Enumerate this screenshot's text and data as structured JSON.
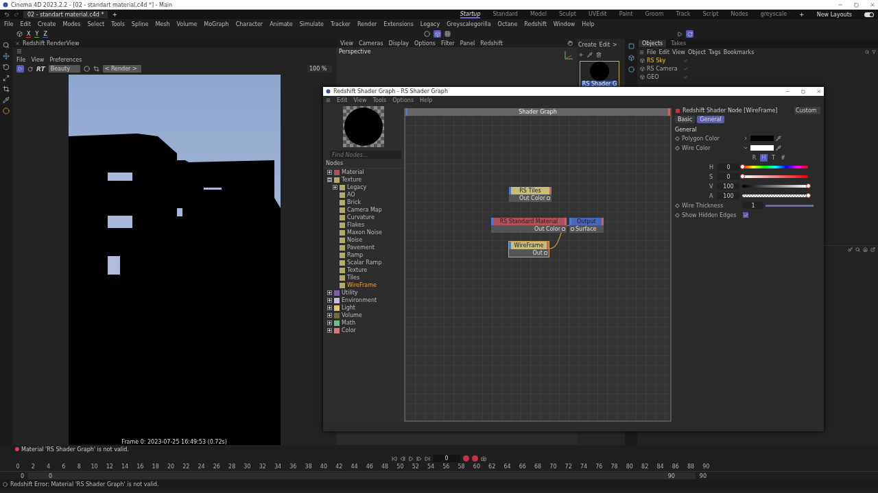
{
  "window": {
    "title": "Cinema 4D 2023.2.2 - [02 - standart material.c4d *] - Main"
  },
  "doc_tabs": [
    {
      "label": "02 - standart material.c4d *",
      "selected": true
    }
  ],
  "add_tab": "+",
  "layouts": [
    {
      "label": "Startup",
      "selected": true
    },
    {
      "label": "Standard",
      "selected": false
    },
    {
      "label": "Model",
      "selected": false
    },
    {
      "label": "Sculpt",
      "selected": false
    },
    {
      "label": "UVEdit",
      "selected": false
    },
    {
      "label": "Paint",
      "selected": false
    },
    {
      "label": "Groom",
      "selected": false
    },
    {
      "label": "Track",
      "selected": false
    },
    {
      "label": "Script",
      "selected": false
    },
    {
      "label": "Nodes",
      "selected": false
    },
    {
      "label": "greyscale",
      "selected": false
    }
  ],
  "layout_add": "+",
  "new_layouts": {
    "label": "New Layouts",
    "on": true
  },
  "menu": [
    "File",
    "Edit",
    "Create",
    "Modes",
    "Select",
    "Tools",
    "Spline",
    "Mesh",
    "Volume",
    "MoGraph",
    "Character",
    "Animate",
    "Simulate",
    "Tracker",
    "Render",
    "Extensions",
    "Legacy",
    "Greyscalegorilla",
    "Octane",
    "Redshift",
    "Window",
    "Help"
  ],
  "axis_buttons": [
    "X",
    "Y",
    "Z"
  ],
  "render_view": {
    "title": "Redshift RenderView",
    "menu": [
      "File",
      "View",
      "Preferences"
    ],
    "rt": "RT",
    "aov": "Beauty",
    "render_dropdown": "< Render >",
    "zoom": "100 %",
    "caption": "Frame 0:  2023-07-25  16:49:53  (0.72s)"
  },
  "viewport": {
    "menu": [
      "View",
      "Cameras",
      "Display",
      "Options",
      "Filter",
      "Panel",
      "Redshift"
    ],
    "camera": "Perspective"
  },
  "material_manager": {
    "menu": [
      "Create",
      "Edit",
      ">"
    ],
    "materials": [
      {
        "name": "RS Shader G",
        "selected": true
      }
    ]
  },
  "objects": {
    "tabs": [
      {
        "label": "Objects",
        "selected": true
      },
      {
        "label": "Takes",
        "selected": false
      }
    ],
    "menu": [
      "File",
      "Edit",
      "View",
      "Object",
      "Tags",
      "Bookmarks"
    ],
    "items": [
      {
        "name": "RS Sky",
        "selected": true
      },
      {
        "name": "RS Camera",
        "selected": false
      },
      {
        "name": "GEO",
        "selected": false
      }
    ]
  },
  "shader_graph": {
    "title": "Redshift Shader Graph - RS Shader Graph",
    "menu": [
      "Edit",
      "View",
      "Tools",
      "Options",
      "Help"
    ],
    "search_placeholder": "Find Nodes...",
    "nodes_header": "Nodes",
    "node_tree": [
      {
        "label": "Material",
        "color": "#a8525a",
        "expanded": false,
        "selected": false
      },
      {
        "label": "Texture",
        "color": "#b3ab6c",
        "expanded": true,
        "selected": false,
        "children": [
          {
            "label": "Legacy",
            "color": "#b3ab6c",
            "expanded": false,
            "selected": false
          },
          {
            "label": "AO",
            "color": "#b3ab6c",
            "selected": false
          },
          {
            "label": "Brick",
            "color": "#b3ab6c",
            "selected": false
          },
          {
            "label": "Camera Map",
            "color": "#b3ab6c",
            "selected": false
          },
          {
            "label": "Curvature",
            "color": "#b3ab6c",
            "selected": false
          },
          {
            "label": "Flakes",
            "color": "#b3ab6c",
            "selected": false
          },
          {
            "label": "Maxon Noise",
            "color": "#b3ab6c",
            "selected": false
          },
          {
            "label": "Noise",
            "color": "#b3ab6c",
            "selected": false
          },
          {
            "label": "Pavement",
            "color": "#b3ab6c",
            "selected": false
          },
          {
            "label": "Ramp",
            "color": "#b3ab6c",
            "selected": false
          },
          {
            "label": "Scalar Ramp",
            "color": "#b3ab6c",
            "selected": false
          },
          {
            "label": "Texture",
            "color": "#b3ab6c",
            "selected": false
          },
          {
            "label": "Tiles",
            "color": "#b3ab6c",
            "selected": false
          },
          {
            "label": "WireFrame",
            "color": "#b3ab6c",
            "selected": true
          }
        ]
      },
      {
        "label": "Utility",
        "color": "#7a62b0",
        "expanded": false,
        "selected": false
      },
      {
        "label": "Environment",
        "color": "#c9b8e0",
        "expanded": false,
        "selected": false
      },
      {
        "label": "Light",
        "color": "#e0c870",
        "expanded": false,
        "selected": false
      },
      {
        "label": "Volume",
        "color": "#6e6a44",
        "expanded": false,
        "selected": false
      },
      {
        "label": "Math",
        "color": "#6cbf8a",
        "expanded": false,
        "selected": false
      },
      {
        "label": "Color",
        "color": "#d47a7a",
        "expanded": false,
        "selected": false
      }
    ],
    "canvas_title": "Shader Graph",
    "graph_nodes": [
      {
        "kind": "shader",
        "title": "RS Tiles",
        "port": "Out Color",
        "color": "#c9bd72",
        "selected": false
      },
      {
        "kind": "shader",
        "title": "RS Standard Material",
        "port": "Out Color",
        "color": "#b0505a",
        "selected": false
      },
      {
        "kind": "shader",
        "title": "WireFrame",
        "port": "Out",
        "color": "#c9bd72",
        "selected": true
      },
      {
        "kind": "output",
        "title": "Output",
        "port": "Surface",
        "color": "#4a66b8",
        "selected": false
      }
    ],
    "properties": {
      "title": "Redshift Shader Node [WireFrame]",
      "preset": "Custom",
      "tabs": [
        {
          "label": "Basic",
          "selected": false
        },
        {
          "label": "General",
          "selected": true
        }
      ],
      "section": "General",
      "fields": [
        {
          "label": "Polygon Color",
          "color": "#000000",
          "expanded": false
        },
        {
          "label": "Wire Color",
          "color": "#ffffff",
          "expanded": true
        }
      ],
      "color_modes": [
        {
          "label": "R",
          "selected": false
        },
        {
          "label": "H",
          "selected": true
        },
        {
          "label": "T",
          "selected": false
        },
        {
          "label": "#",
          "selected": false
        }
      ],
      "channels": [
        {
          "name": "H",
          "value": "0",
          "level": 0
        },
        {
          "name": "S",
          "value": "0",
          "level": 0
        },
        {
          "name": "V",
          "value": "100",
          "level": 1
        },
        {
          "name": "A",
          "value": "100",
          "level": 1
        }
      ],
      "wire_thickness": {
        "label": "Wire Thickness",
        "value": "1",
        "level": 1
      },
      "show_hidden_edges": {
        "label": "Show Hidden Edges",
        "checked": true
      }
    }
  },
  "status": {
    "message": "Material 'RS Shader Graph' is not valid.",
    "error": "Redshift Error: Material 'RS Shader Graph' is not valid."
  },
  "timeline": {
    "frame": "0",
    "ticks": [
      "0",
      "2",
      "4",
      "6",
      "8",
      "10",
      "12",
      "14",
      "16",
      "18",
      "20",
      "22",
      "24",
      "26",
      "28",
      "30",
      "32",
      "34",
      "36",
      "38",
      "40",
      "42",
      "44",
      "46",
      "48",
      "50",
      "52",
      "54",
      "56",
      "58",
      "60",
      "62",
      "64",
      "66",
      "68",
      "70",
      "72",
      "74",
      "76",
      "78",
      "80",
      "82",
      "84",
      "86",
      "88",
      "90"
    ],
    "start": "0",
    "range_start": "0",
    "range_end": "90",
    "end": "90"
  }
}
